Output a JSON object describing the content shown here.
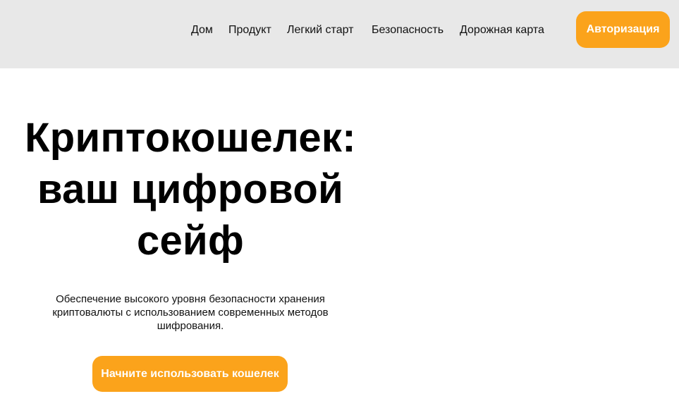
{
  "header": {
    "nav": [
      {
        "label": "Дом"
      },
      {
        "label": "Продукт"
      },
      {
        "label": "Легкий старт"
      },
      {
        "label": "Безопасность"
      },
      {
        "label": "Дорожная карта"
      }
    ],
    "login_label": "Авторизация"
  },
  "hero": {
    "title": "Криптокошелек: ваш цифровой сейф",
    "subtitle": "Обеспечение высокого уровня безопасности хранения криптовалюты с использованием современных методов шифрования.",
    "cta_label": "Начните использовать кошелек"
  },
  "colors": {
    "header_bg": "#e8e8e8",
    "accent": "#fba31b",
    "text": "#000000",
    "page_bg": "#ffffff"
  }
}
